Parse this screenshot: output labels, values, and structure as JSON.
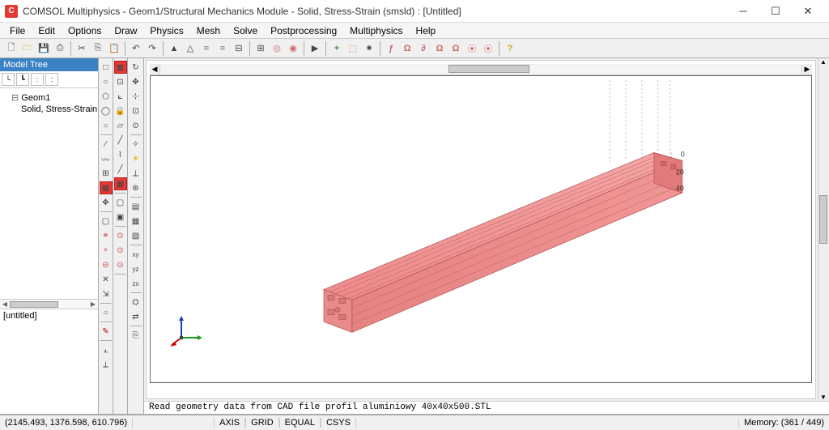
{
  "window": {
    "title": "COMSOL Multiphysics - Geom1/Structural Mechanics Module - Solid, Stress-Strain (smsld) : [Untitled]"
  },
  "menus": [
    "File",
    "Edit",
    "Options",
    "Draw",
    "Physics",
    "Mesh",
    "Solve",
    "Postprocessing",
    "Multiphysics",
    "Help"
  ],
  "model_tree": {
    "title": "Model Tree",
    "root": "Geom1",
    "child": "Solid, Stress-Strain (sm",
    "bottom_tab": "[untitled]"
  },
  "viewport": {
    "axis_values": [
      "0",
      "20",
      "40"
    ]
  },
  "log": {
    "message": "Read geometry data from CAD file profil aluminiowy 40x40x500.STL"
  },
  "status": {
    "coords": "(2145.493, 1376.598, 610.796)",
    "modes": [
      "AXIS",
      "GRID",
      "EQUAL",
      "CSYS"
    ],
    "memory": "Memory: (361 / 449)"
  }
}
